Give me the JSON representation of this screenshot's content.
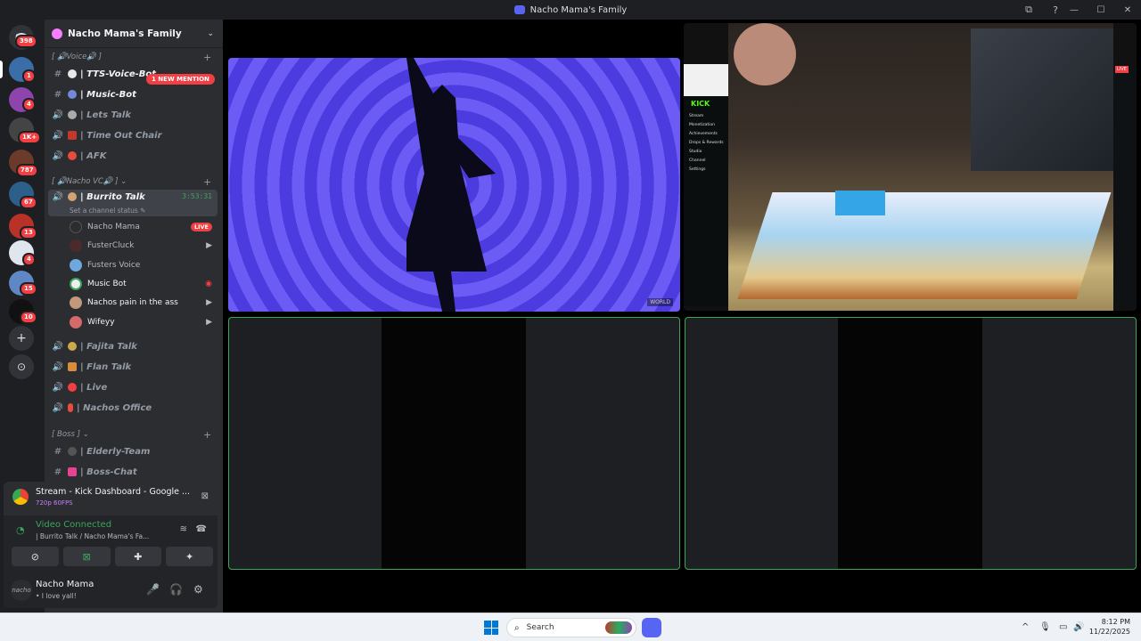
{
  "window": {
    "title": "Nacho Mama's Family",
    "minimize": "—",
    "maximize": "☐",
    "close": "✕",
    "help": "?",
    "inbox": "⧉"
  },
  "servers": {
    "home_badge": "398",
    "badges": [
      "1",
      "4",
      "1K+",
      "787",
      "67",
      "13",
      "4",
      "15",
      "10"
    ],
    "add": "+",
    "explore": "⊙"
  },
  "server_header": {
    "name": "Nacho Mama's Family",
    "chevron": "⌄"
  },
  "mention_pill": "1 NEW MENTION",
  "categories": {
    "voice": {
      "label": "[ 🔊Voice🔊 ]",
      "plus": "+"
    },
    "nacho_vc": {
      "label": "[ 🔊Nacho VC🔊 ] ⌄",
      "plus": "+"
    },
    "boss": {
      "label": "[ Boss ] ⌄",
      "plus": "+"
    }
  },
  "channels": {
    "tts": "| TTS-Voice-Bot",
    "music": "| Music-Bot",
    "lets_talk": "| Lets Talk",
    "time_out": "| Time Out Chair",
    "afk": "| AFK",
    "burrito": "| Burrito Talk",
    "burrito_timer": "3:53:31",
    "burrito_status": "Set a channel status ✎",
    "fajita": "| Fajita Talk",
    "flan": "| Flan Talk",
    "live": "| Live",
    "nachos_office": "| Nachos Office",
    "elderly": "| Elderly-Team",
    "boss_chat": "| Boss-Chat"
  },
  "voice_users": [
    {
      "name": "Nacho Mama",
      "live": "LIVE"
    },
    {
      "name": "FusterCluck"
    },
    {
      "name": "Fusters Voice"
    },
    {
      "name": "Music Bot"
    },
    {
      "name": "Nachos pain in the ass"
    },
    {
      "name": "Wifeyy"
    }
  ],
  "stream": {
    "title": "Stream - Kick Dashboard - Google ...",
    "quality": "720p 60FPS"
  },
  "voice_connection": {
    "status": "Video Connected",
    "channel": "| Burrito Talk / Nacho Mama's Fa..."
  },
  "user": {
    "name": "Nacho Mama",
    "status": "• I love yall!",
    "avatar": "nacho"
  },
  "kick": {
    "logo": "KICK",
    "menu": [
      "Stream",
      "Monetization",
      "Achievements",
      "Drops & Rewards",
      "Studio",
      "Channel",
      "Settings"
    ],
    "live": "LIVE"
  },
  "video_watermark": "WORLD",
  "taskbar": {
    "search_placeholder": "Search",
    "time": "8:12 PM",
    "date": "11/22/2025",
    "tray_up": "^",
    "tray_mic": "🎙",
    "tray_net": "▭",
    "tray_vol": "🔊"
  },
  "colors": {
    "accent": "#5865f2",
    "connected": "#3ba55c",
    "danger": "#f23f43",
    "kick": "#53fc18"
  }
}
